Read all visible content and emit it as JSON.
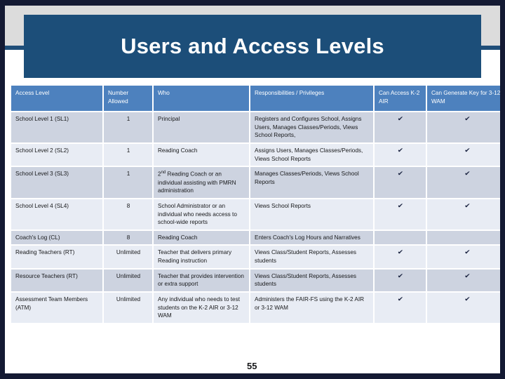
{
  "slide": {
    "title": "Users and Access Levels",
    "slide_number": "55",
    "accent_navy": "#1C4E79",
    "accent_header_blue": "#4D81BE",
    "band_a": "#CDD3E0",
    "band_b": "#E8ECF4",
    "frame_color": "#141A33",
    "gray_band": "#DCDCDC"
  },
  "table": {
    "headers": [
      "Access Level",
      "Number Allowed",
      "Who",
      "Responsibilities / Privileges",
      "Can Access K-2 AIR",
      "Can Generate Key for 3-12 WAM"
    ],
    "check_glyph": "✔",
    "rows": [
      {
        "access_level": "School Level 1 (SL1)",
        "number_allowed": "1",
        "who": "Principal",
        "who_sup": "",
        "who_rest": "",
        "responsibilities": "Registers and Configures School, Assigns Users, Manages Classes/Periods, Views School Reports,",
        "can_access_k2_air": "✔",
        "can_generate_key_312_wam": "✔"
      },
      {
        "access_level": "School Level 2 (SL2)",
        "number_allowed": "1",
        "who": "Reading Coach",
        "who_sup": "",
        "who_rest": "",
        "responsibilities": "Assigns Users, Manages Classes/Periods, Views School Reports",
        "can_access_k2_air": "✔",
        "can_generate_key_312_wam": "✔"
      },
      {
        "access_level": "School Level 3 (SL3)",
        "number_allowed": "1",
        "who": "2",
        "who_sup": "nd",
        "who_rest": " Reading Coach or an individual assisting with PMRN administration",
        "responsibilities": "Manages Classes/Periods, Views School Reports",
        "can_access_k2_air": "✔",
        "can_generate_key_312_wam": "✔"
      },
      {
        "access_level": "School Level 4 (SL4)",
        "number_allowed": "8",
        "who": "School Administrator or an individual who needs access to school-wide reports",
        "who_sup": "",
        "who_rest": "",
        "responsibilities": "Views School Reports",
        "can_access_k2_air": "✔",
        "can_generate_key_312_wam": "✔"
      },
      {
        "access_level": "Coach's Log (CL)",
        "number_allowed": "8",
        "who": "Reading Coach",
        "who_sup": "",
        "who_rest": "",
        "responsibilities": "Enters Coach's Log Hours and Narratives",
        "can_access_k2_air": "",
        "can_generate_key_312_wam": ""
      },
      {
        "access_level": "Reading Teachers (RT)",
        "number_allowed": "Unlimited",
        "who": "Teacher that delivers primary Reading instruction",
        "who_sup": "",
        "who_rest": "",
        "responsibilities": "Views Class/Student Reports, Assesses students",
        "can_access_k2_air": "✔",
        "can_generate_key_312_wam": "✔"
      },
      {
        "access_level": "Resource Teachers (RT)",
        "number_allowed": "Unlimited",
        "who": "Teacher that provides intervention or extra support",
        "who_sup": "",
        "who_rest": "",
        "responsibilities": "Views Class/Student Reports, Assesses students",
        "can_access_k2_air": "✔",
        "can_generate_key_312_wam": "✔"
      },
      {
        "access_level": "Assessment Team Members (ATM)",
        "number_allowed": "Unlimited",
        "who": "Any individual who needs to test students on the K-2 AIR or 3-12 WAM",
        "who_sup": "",
        "who_rest": "",
        "responsibilities": "Administers the FAIR-FS using the K-2 AIR or 3-12 WAM",
        "can_access_k2_air": "✔",
        "can_generate_key_312_wam": "✔"
      }
    ]
  }
}
